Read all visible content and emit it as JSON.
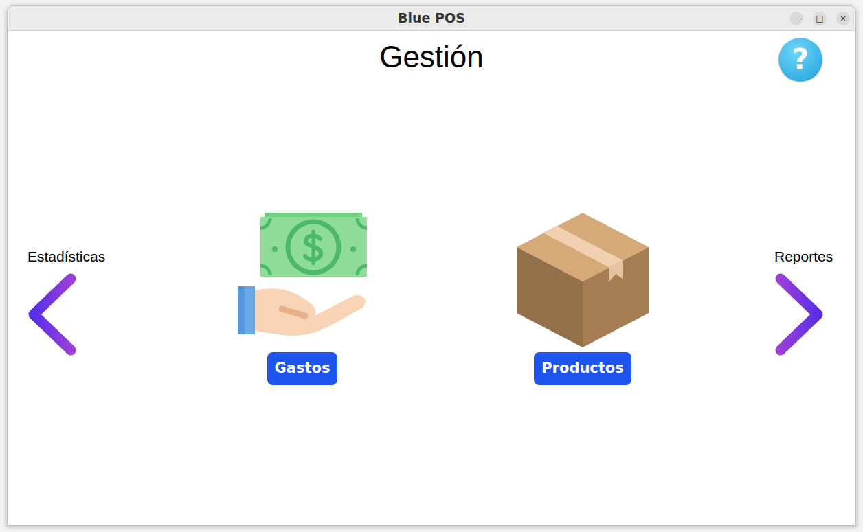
{
  "window": {
    "title": "Blue POS",
    "controls": [
      "–",
      "□",
      "×"
    ]
  },
  "header": {
    "title": "Gestión",
    "help": "?"
  },
  "nav": {
    "prev": {
      "label": "Estadísticas"
    },
    "next": {
      "label": "Reportes"
    }
  },
  "modules": [
    {
      "label": "Gastos"
    },
    {
      "label": "Productos"
    }
  ]
}
